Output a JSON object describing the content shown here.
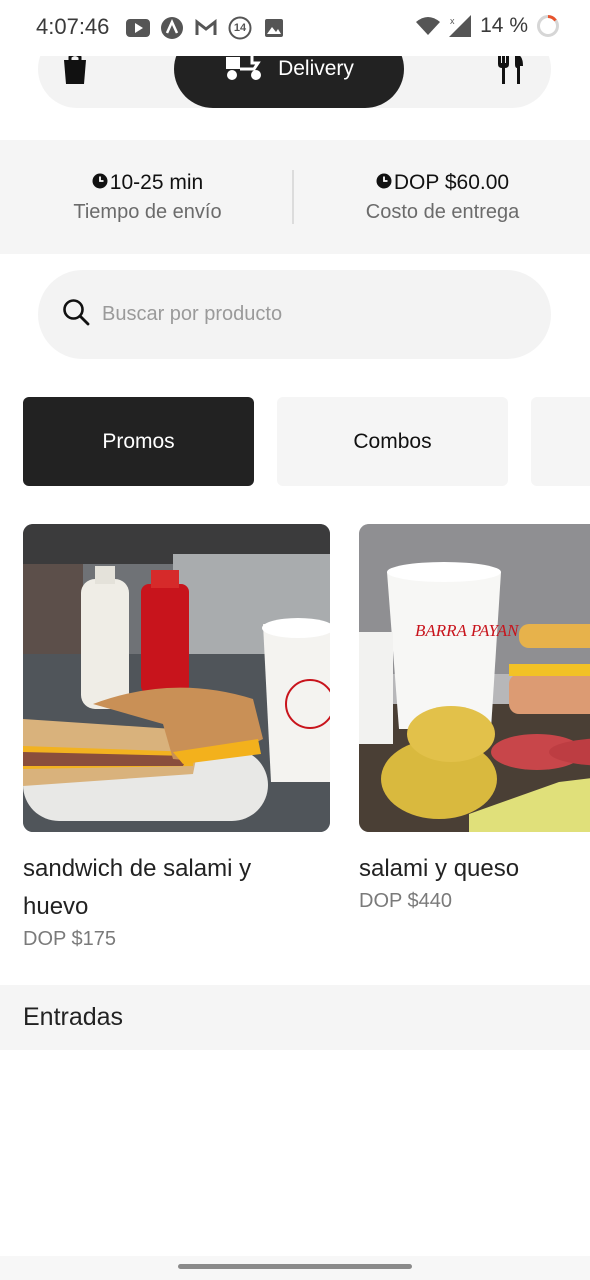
{
  "status_bar": {
    "time": "4:07:46",
    "notification_badge": "14",
    "battery": "14 %"
  },
  "mode_toggle": {
    "active_label": "Delivery"
  },
  "info": {
    "time_value": "10-25 min",
    "time_label": "Tiempo de envío",
    "cost_value": "DOP $60.00",
    "cost_label": "Costo de entrega"
  },
  "search": {
    "placeholder": "Buscar por producto"
  },
  "categories": [
    {
      "label": "Promos"
    },
    {
      "label": "Combos"
    },
    {
      "label": ""
    }
  ],
  "products": [
    {
      "name": "sandwich de salami y huevo",
      "price": "DOP $175"
    },
    {
      "name": "salami y queso",
      "price": "DOP $440",
      "cup_text": "BARRA PAYAN"
    }
  ],
  "section": {
    "title": "Entradas"
  },
  "colors": {
    "accent_dark": "#222222",
    "surface": "#f5f5f5",
    "sauce_red": "#c8141c"
  }
}
